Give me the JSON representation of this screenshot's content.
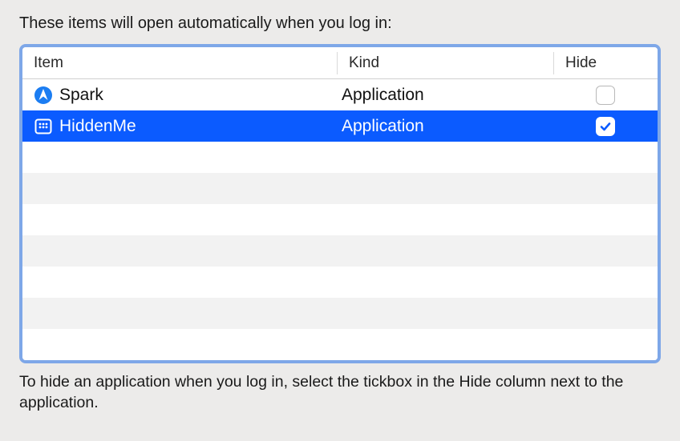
{
  "heading": "These items will open automatically when you log in:",
  "columns": {
    "item": "Item",
    "kind": "Kind",
    "hide": "Hide"
  },
  "rows": [
    {
      "icon": "spark-icon",
      "name": "Spark",
      "kind": "Application",
      "hide": false,
      "selected": false
    },
    {
      "icon": "hiddenme-icon",
      "name": "HiddenMe",
      "kind": "Application",
      "hide": true,
      "selected": true
    }
  ],
  "empty_rows": 7,
  "footer": "To hide an application when you log in, select the tickbox in the Hide column next to the application."
}
